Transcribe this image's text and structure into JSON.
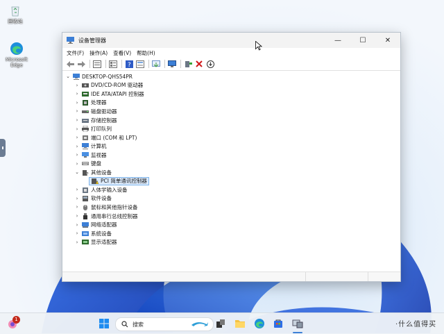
{
  "desktop": {
    "icons": [
      {
        "label": "回收站",
        "icon": "recycle-bin-icon"
      },
      {
        "label": "Microsoft Edge",
        "icon": "edge-icon"
      }
    ]
  },
  "window": {
    "title": "设备管理器",
    "controls": {
      "minimize": "—",
      "maximize": "☐",
      "close": "✕"
    },
    "menu": [
      "文件(F)",
      "操作(A)",
      "查看(V)",
      "帮助(H)"
    ],
    "toolbar_icons": [
      "back-icon",
      "forward-icon",
      "properties-icon",
      "show-hide-icon",
      "help-icon",
      "view-icon",
      "update-driver-icon",
      "monitor-icon",
      "enable-device-icon",
      "uninstall-icon",
      "disable-icon"
    ],
    "tree": {
      "root": "DESKTOP-QHS54PR",
      "items": [
        {
          "label": "DVD/CD-ROM 驱动器",
          "icon": "dvd-drive-icon",
          "expanded": false
        },
        {
          "label": "IDE ATA/ATAPI 控制器",
          "icon": "ide-controller-icon",
          "expanded": false
        },
        {
          "label": "处理器",
          "icon": "processor-icon",
          "expanded": false
        },
        {
          "label": "磁盘驱动器",
          "icon": "disk-drive-icon",
          "expanded": false
        },
        {
          "label": "存储控制器",
          "icon": "storage-controller-icon",
          "expanded": false
        },
        {
          "label": "打印队列",
          "icon": "printer-icon",
          "expanded": false
        },
        {
          "label": "端口 (COM 和 LPT)",
          "icon": "port-icon",
          "expanded": false
        },
        {
          "label": "计算机",
          "icon": "computer-icon",
          "expanded": false
        },
        {
          "label": "监视器",
          "icon": "monitor-icon",
          "expanded": false
        },
        {
          "label": "键盘",
          "icon": "keyboard-icon",
          "expanded": false
        },
        {
          "label": "其他设备",
          "icon": "unknown-device-icon",
          "expanded": true
        },
        {
          "label": "PCI 简单通讯控制器",
          "icon": "warning-device-icon",
          "child": true,
          "selected": true
        },
        {
          "label": "人体学输入设备",
          "icon": "hid-icon",
          "expanded": false
        },
        {
          "label": "软件设备",
          "icon": "software-device-icon",
          "expanded": false
        },
        {
          "label": "鼠标和其他指针设备",
          "icon": "mouse-icon",
          "expanded": false
        },
        {
          "label": "通用串行总线控制器",
          "icon": "usb-icon",
          "expanded": false
        },
        {
          "label": "网络适配器",
          "icon": "network-adapter-icon",
          "expanded": false
        },
        {
          "label": "系统设备",
          "icon": "system-device-icon",
          "expanded": false
        },
        {
          "label": "显示适配器",
          "icon": "display-adapter-icon",
          "expanded": false
        }
      ]
    }
  },
  "taskbar": {
    "notification_count": "1",
    "search_placeholder": "搜索",
    "apps": [
      "widgets-icon",
      "start-icon",
      "task-view-icon",
      "file-explorer-icon",
      "edge-icon",
      "store-icon",
      "device-manager-icon"
    ]
  },
  "watermark": "·什么值得买"
}
